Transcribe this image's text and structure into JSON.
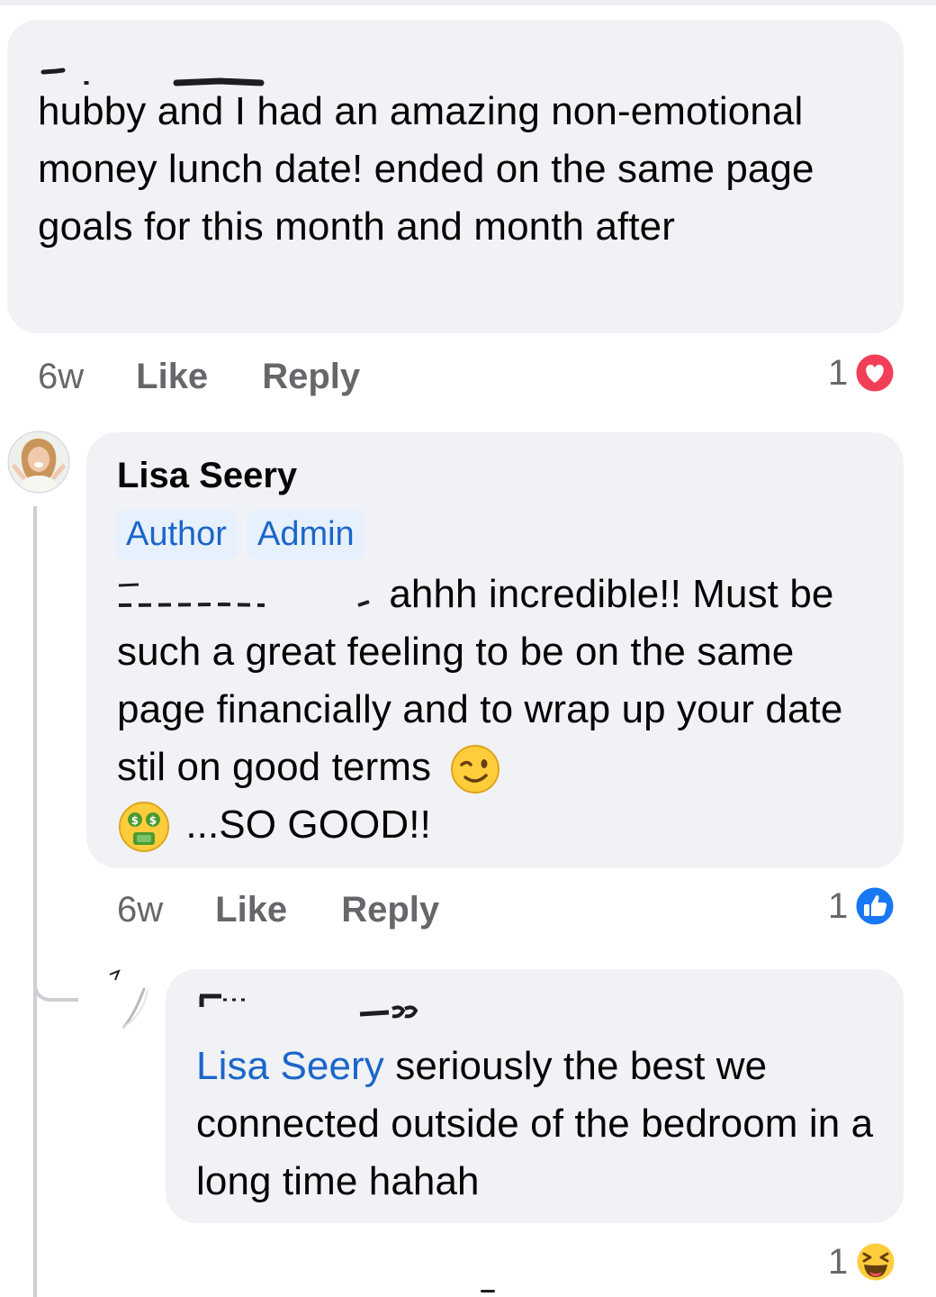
{
  "comments": [
    {
      "text": "hubby and I had an amazing non-emotional money lunch date! ended on the same page goals for this month and month after",
      "time": "6w",
      "like_label": "Like",
      "reply_label": "Reply",
      "reaction_count": "1",
      "reaction_icon": "heart-reaction-icon"
    },
    {
      "author": "Lisa Seery",
      "badges": [
        "Author",
        "Admin"
      ],
      "text": "ahhh incredible!! Must be such a great feeling to be on the same page financially and to wrap up your date stil on good terms",
      "text_end": "...SO GOOD!!",
      "emojis": [
        "winking-face-icon",
        "money-mouth-face-icon"
      ],
      "time": "6w",
      "like_label": "Like",
      "reply_label": "Reply",
      "reaction_count": "1",
      "reaction_icon": "like-reaction-icon"
    },
    {
      "mention": "Lisa Seery",
      "text": " seriously the best we connected outside of the bedroom in a long time hahah",
      "reaction_count": "1",
      "reaction_icon": "laughing-reaction-icon"
    }
  ],
  "colors": {
    "bubble": "#f0f2f5",
    "meta": "#65676b",
    "link": "#1b66c9",
    "heart": "#f33e58",
    "like": "#1877f2"
  }
}
